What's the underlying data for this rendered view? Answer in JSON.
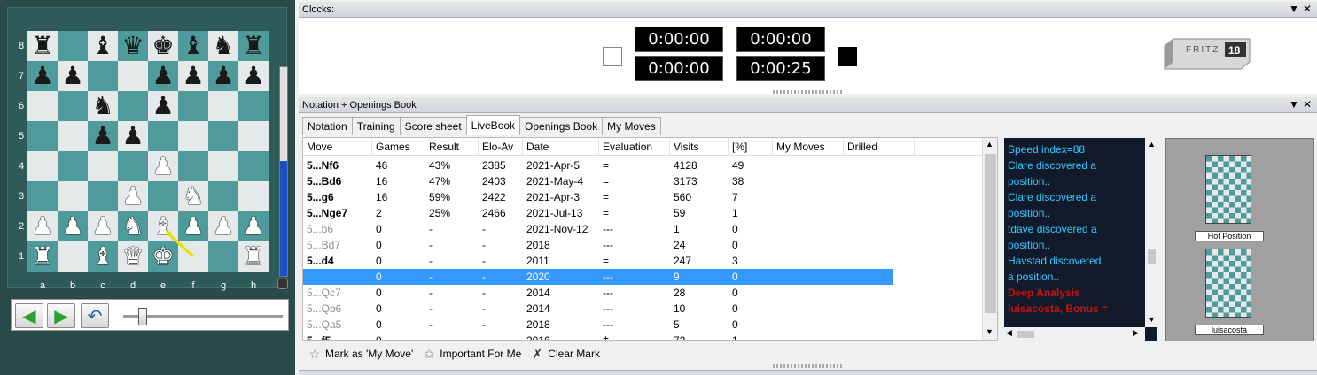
{
  "board": {
    "ranks": [
      "8",
      "7",
      "6",
      "5",
      "4",
      "3",
      "2",
      "1"
    ],
    "files": [
      "a",
      "b",
      "c",
      "d",
      "e",
      "f",
      "g",
      "h"
    ],
    "position": [
      [
        "bR",
        "",
        "bB",
        "bQ",
        "bK",
        "bB",
        "bN",
        "bR"
      ],
      [
        "bP",
        "bP",
        "",
        "",
        "bP",
        "bP",
        "bP",
        "bP"
      ],
      [
        "",
        "",
        "bN",
        "",
        "bP",
        "",
        "",
        ""
      ],
      [
        "",
        "",
        "bP",
        "bP",
        "",
        "",
        "",
        ""
      ],
      [
        "",
        "",
        "",
        "",
        "wP",
        "",
        "",
        ""
      ],
      [
        "",
        "",
        "",
        "wP",
        "",
        "wN",
        "",
        ""
      ],
      [
        "wP",
        "wP",
        "wP",
        "wN",
        "wB",
        "wP",
        "wP",
        "wP"
      ],
      [
        "wR",
        "",
        "wB",
        "wQ",
        "wK",
        "",
        "",
        "wR"
      ]
    ],
    "eval_fill": 0.55,
    "arrow_color": "#e8e000"
  },
  "nav": {
    "back_icon": "arrow-left-icon",
    "forward_icon": "arrow-right-icon",
    "undo_icon": "undo-icon",
    "slider_position": 0.1
  },
  "clocks_pane": {
    "title": "Clocks:",
    "pin": "▼",
    "close": "✕",
    "white_total": "0:00:00",
    "white_move": "0:00:00",
    "black_total": "0:00:00",
    "black_move": "0:00:25",
    "logo_text": "FRITZ",
    "logo_version": "18"
  },
  "notation_pane": {
    "title": "Notation + Openings Book",
    "pin": "▼",
    "close": "✕",
    "tabs": [
      "Notation",
      "Training",
      "Score sheet",
      "LiveBook",
      "Openings Book",
      "My Moves"
    ],
    "active_tab": "LiveBook"
  },
  "book": {
    "columns": [
      "Move",
      "Games",
      "Result",
      "Elo-Av",
      "Date",
      "Evaluation",
      "Visits",
      "[%]",
      "My Moves",
      "Drilled"
    ],
    "rows": [
      {
        "move": "5...Nf6",
        "games": "46",
        "result": "43%",
        "elo": "2385",
        "date": "2021-Apr-5",
        "eval": "=",
        "visits": "4128",
        "pct": "49",
        "style": "bold"
      },
      {
        "move": "5...Bd6",
        "games": "16",
        "result": "47%",
        "elo": "2403",
        "date": "2021-May-4",
        "eval": "=",
        "visits": "3173",
        "pct": "38",
        "style": "bold"
      },
      {
        "move": "5...g6",
        "games": "16",
        "result": "59%",
        "elo": "2422",
        "date": "2021-Apr-3",
        "eval": "=",
        "visits": "560",
        "pct": "7",
        "style": "bold"
      },
      {
        "move": "5...Nge7",
        "games": "2",
        "result": "25%",
        "elo": "2466",
        "date": "2021-Jul-13",
        "eval": "=",
        "visits": "59",
        "pct": "1",
        "style": "bold"
      },
      {
        "move": "5...b6",
        "games": "0",
        "result": "-",
        "elo": "-",
        "date": "2021-Nov-12",
        "eval": "---",
        "visits": "1",
        "pct": "0",
        "style": "grey"
      },
      {
        "move": "5...Bd7",
        "games": "0",
        "result": "-",
        "elo": "-",
        "date": "2018",
        "eval": "---",
        "visits": "24",
        "pct": "0",
        "style": "grey"
      },
      {
        "move": "5...d4",
        "games": "0",
        "result": "-",
        "elo": "-",
        "date": "2011",
        "eval": "=",
        "visits": "247",
        "pct": "3",
        "style": "bold"
      },
      {
        "move": "",
        "games": "0",
        "result": "-",
        "elo": "-",
        "date": "2020",
        "eval": "---",
        "visits": "9",
        "pct": "0",
        "style": "selected"
      },
      {
        "move": "5...Qc7",
        "games": "0",
        "result": "-",
        "elo": "-",
        "date": "2014",
        "eval": "---",
        "visits": "28",
        "pct": "0",
        "style": "grey"
      },
      {
        "move": "5...Qb6",
        "games": "0",
        "result": "-",
        "elo": "-",
        "date": "2014",
        "eval": "---",
        "visits": "10",
        "pct": "0",
        "style": "grey"
      },
      {
        "move": "5...Qa5",
        "games": "0",
        "result": "-",
        "elo": "-",
        "date": "2018",
        "eval": "---",
        "visits": "5",
        "pct": "0",
        "style": "grey"
      },
      {
        "move": "5...f5",
        "games": "0",
        "result": "-",
        "elo": "-",
        "date": "2016",
        "eval": "⩲",
        "visits": "72",
        "pct": "1",
        "style": "bold"
      }
    ]
  },
  "toolbar": {
    "mark_my_move": "Mark as 'My Move'",
    "important": "Important For Me",
    "clear_mark": "Clear Mark"
  },
  "chat": {
    "lines": [
      {
        "text": "Speed index=88",
        "color": "#33ccff"
      },
      {
        "text": "Clare discovered a",
        "color": "#33ccff"
      },
      {
        "text": "position..",
        "color": "#33ccff"
      },
      {
        "text": "Clare discovered a",
        "color": "#33ccff"
      },
      {
        "text": "position..",
        "color": "#33ccff"
      },
      {
        "text": "tdave discovered a",
        "color": "#33ccff"
      },
      {
        "text": "position..",
        "color": "#33ccff"
      },
      {
        "text": "Havstad discovered",
        "color": "#33ccff"
      },
      {
        "text": "a position..",
        "color": "#33ccff"
      },
      {
        "text": "Deep Analysis",
        "color": "#cc1111"
      },
      {
        "text": "luisacosta, Bonus =",
        "color": "#cc1111"
      }
    ]
  },
  "hot_positions": {
    "label1": "Hot Position",
    "label2": "luisacosta"
  }
}
